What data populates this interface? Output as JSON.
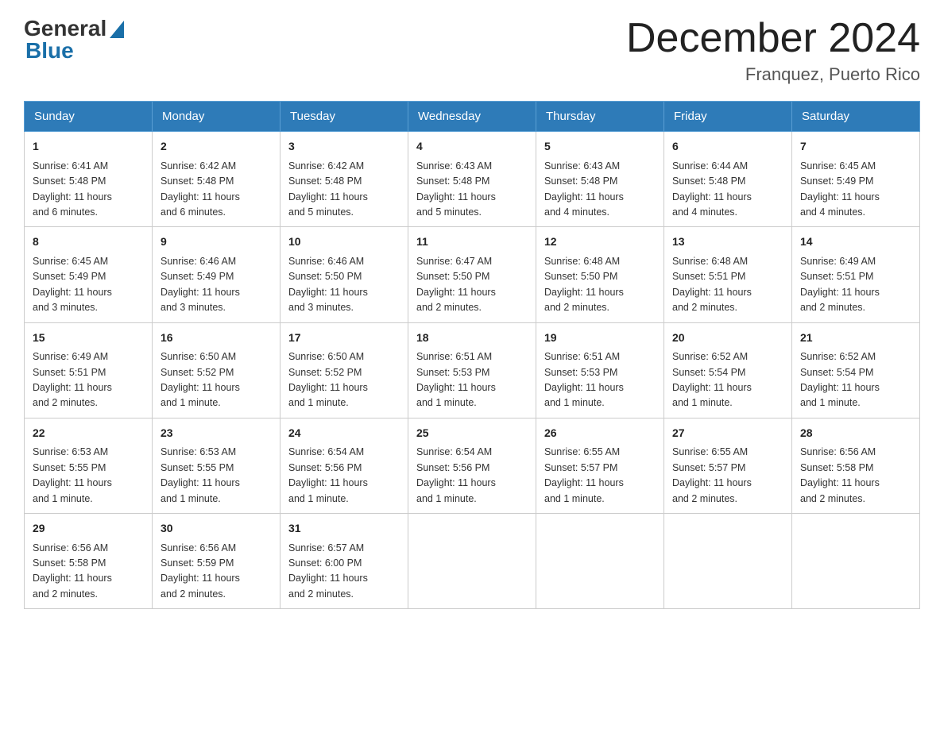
{
  "logo": {
    "general": "General",
    "blue": "Blue"
  },
  "title": "December 2024",
  "subtitle": "Franquez, Puerto Rico",
  "days_header": [
    "Sunday",
    "Monday",
    "Tuesday",
    "Wednesday",
    "Thursday",
    "Friday",
    "Saturday"
  ],
  "weeks": [
    [
      {
        "num": "1",
        "sunrise": "6:41 AM",
        "sunset": "5:48 PM",
        "daylight": "11 hours and 6 minutes."
      },
      {
        "num": "2",
        "sunrise": "6:42 AM",
        "sunset": "5:48 PM",
        "daylight": "11 hours and 6 minutes."
      },
      {
        "num": "3",
        "sunrise": "6:42 AM",
        "sunset": "5:48 PM",
        "daylight": "11 hours and 5 minutes."
      },
      {
        "num": "4",
        "sunrise": "6:43 AM",
        "sunset": "5:48 PM",
        "daylight": "11 hours and 5 minutes."
      },
      {
        "num": "5",
        "sunrise": "6:43 AM",
        "sunset": "5:48 PM",
        "daylight": "11 hours and 4 minutes."
      },
      {
        "num": "6",
        "sunrise": "6:44 AM",
        "sunset": "5:48 PM",
        "daylight": "11 hours and 4 minutes."
      },
      {
        "num": "7",
        "sunrise": "6:45 AM",
        "sunset": "5:49 PM",
        "daylight": "11 hours and 4 minutes."
      }
    ],
    [
      {
        "num": "8",
        "sunrise": "6:45 AM",
        "sunset": "5:49 PM",
        "daylight": "11 hours and 3 minutes."
      },
      {
        "num": "9",
        "sunrise": "6:46 AM",
        "sunset": "5:49 PM",
        "daylight": "11 hours and 3 minutes."
      },
      {
        "num": "10",
        "sunrise": "6:46 AM",
        "sunset": "5:50 PM",
        "daylight": "11 hours and 3 minutes."
      },
      {
        "num": "11",
        "sunrise": "6:47 AM",
        "sunset": "5:50 PM",
        "daylight": "11 hours and 2 minutes."
      },
      {
        "num": "12",
        "sunrise": "6:48 AM",
        "sunset": "5:50 PM",
        "daylight": "11 hours and 2 minutes."
      },
      {
        "num": "13",
        "sunrise": "6:48 AM",
        "sunset": "5:51 PM",
        "daylight": "11 hours and 2 minutes."
      },
      {
        "num": "14",
        "sunrise": "6:49 AM",
        "sunset": "5:51 PM",
        "daylight": "11 hours and 2 minutes."
      }
    ],
    [
      {
        "num": "15",
        "sunrise": "6:49 AM",
        "sunset": "5:51 PM",
        "daylight": "11 hours and 2 minutes."
      },
      {
        "num": "16",
        "sunrise": "6:50 AM",
        "sunset": "5:52 PM",
        "daylight": "11 hours and 1 minute."
      },
      {
        "num": "17",
        "sunrise": "6:50 AM",
        "sunset": "5:52 PM",
        "daylight": "11 hours and 1 minute."
      },
      {
        "num": "18",
        "sunrise": "6:51 AM",
        "sunset": "5:53 PM",
        "daylight": "11 hours and 1 minute."
      },
      {
        "num": "19",
        "sunrise": "6:51 AM",
        "sunset": "5:53 PM",
        "daylight": "11 hours and 1 minute."
      },
      {
        "num": "20",
        "sunrise": "6:52 AM",
        "sunset": "5:54 PM",
        "daylight": "11 hours and 1 minute."
      },
      {
        "num": "21",
        "sunrise": "6:52 AM",
        "sunset": "5:54 PM",
        "daylight": "11 hours and 1 minute."
      }
    ],
    [
      {
        "num": "22",
        "sunrise": "6:53 AM",
        "sunset": "5:55 PM",
        "daylight": "11 hours and 1 minute."
      },
      {
        "num": "23",
        "sunrise": "6:53 AM",
        "sunset": "5:55 PM",
        "daylight": "11 hours and 1 minute."
      },
      {
        "num": "24",
        "sunrise": "6:54 AM",
        "sunset": "5:56 PM",
        "daylight": "11 hours and 1 minute."
      },
      {
        "num": "25",
        "sunrise": "6:54 AM",
        "sunset": "5:56 PM",
        "daylight": "11 hours and 1 minute."
      },
      {
        "num": "26",
        "sunrise": "6:55 AM",
        "sunset": "5:57 PM",
        "daylight": "11 hours and 1 minute."
      },
      {
        "num": "27",
        "sunrise": "6:55 AM",
        "sunset": "5:57 PM",
        "daylight": "11 hours and 2 minutes."
      },
      {
        "num": "28",
        "sunrise": "6:56 AM",
        "sunset": "5:58 PM",
        "daylight": "11 hours and 2 minutes."
      }
    ],
    [
      {
        "num": "29",
        "sunrise": "6:56 AM",
        "sunset": "5:58 PM",
        "daylight": "11 hours and 2 minutes."
      },
      {
        "num": "30",
        "sunrise": "6:56 AM",
        "sunset": "5:59 PM",
        "daylight": "11 hours and 2 minutes."
      },
      {
        "num": "31",
        "sunrise": "6:57 AM",
        "sunset": "6:00 PM",
        "daylight": "11 hours and 2 minutes."
      },
      null,
      null,
      null,
      null
    ]
  ],
  "labels": {
    "sunrise_prefix": "Sunrise: ",
    "sunset_prefix": "Sunset: ",
    "daylight_prefix": "Daylight: "
  }
}
